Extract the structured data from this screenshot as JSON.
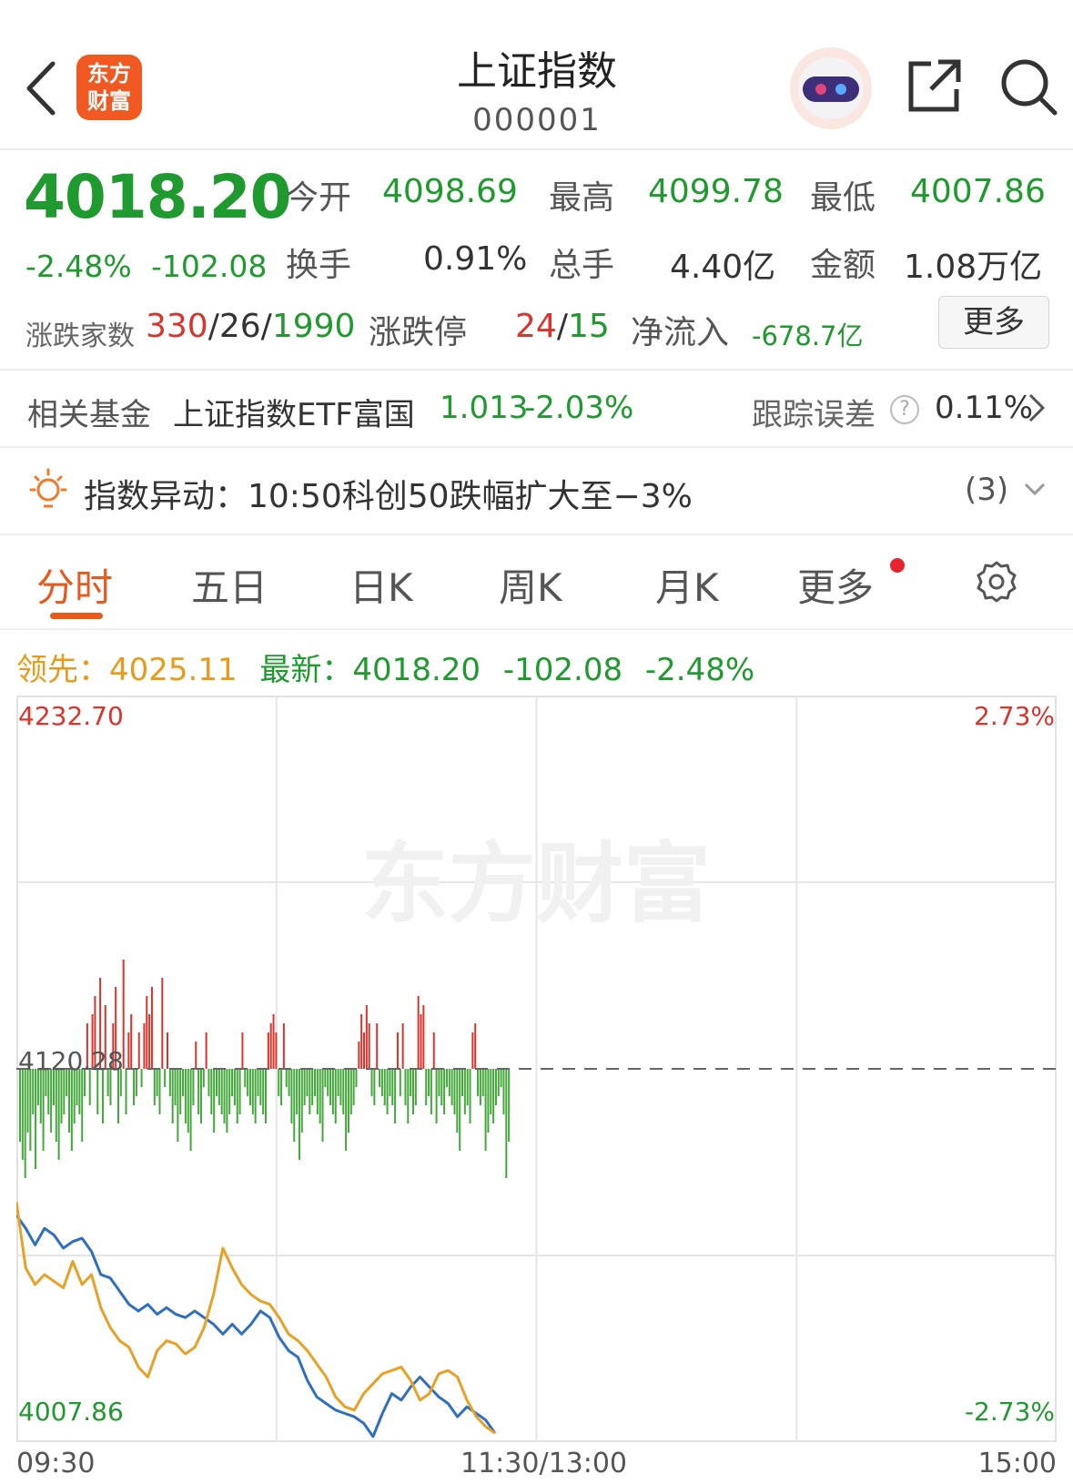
{
  "header": {
    "logo_line1": "东方",
    "logo_line2": "财富",
    "title": "上证指数",
    "code": "000001"
  },
  "quote": {
    "price": "4018.20",
    "change_pct": "-2.48%",
    "change": "-102.08",
    "open_label": "今开",
    "open": "4098.69",
    "high_label": "最高",
    "high": "4099.78",
    "low_label": "最低",
    "low": "4007.86",
    "turnover_label": "换手",
    "turnover": "0.91%",
    "volume_label": "总手",
    "volume": "4.40亿",
    "amount_label": "金额",
    "amount": "1.08万亿",
    "breadth_label": "涨跌家数",
    "breadth_up": "330",
    "breadth_flat": "26",
    "breadth_down": "1990",
    "limit_label": "涨跌停",
    "limit_up": "24",
    "limit_down": "15",
    "netflow_label": "净流入",
    "netflow": "-678.7亿",
    "more_button": "更多"
  },
  "fund": {
    "label": "相关基金",
    "name": "上证指数ETF富国",
    "price": "1.013",
    "pct": "-2.03%",
    "tracking_label": "跟踪误差",
    "tracking_value": "0.11%"
  },
  "alert": {
    "text": "指数异动：10:50科创50跌幅扩大至−3%",
    "count": "(3)"
  },
  "tabs": [
    "分时",
    "五日",
    "日K",
    "周K",
    "月K",
    "更多"
  ],
  "info_line": {
    "lead_label": "领先：",
    "lead_value": "4025.11",
    "latest_label": "最新：",
    "latest_value": "4018.20",
    "latest_change": "-102.08",
    "latest_pct": "-2.48%"
  },
  "chart_data": {
    "type": "line",
    "y_top_label": "4232.70",
    "y_mid_label": "4120.28",
    "y_bottom_label": "4007.86",
    "pct_top_label": "2.73%",
    "pct_bottom_label": "-2.73%",
    "x_labels": [
      "09:30",
      "11:30/13:00",
      "15:00"
    ],
    "ylim": [
      4007.86,
      4232.7
    ],
    "prev_close": 4120.28,
    "watermark": "东方财富",
    "series": [
      {
        "color": "#2f6fbf",
        "values": [
          4076,
          4072,
          4067,
          4072,
          4070,
          4066,
          4068,
          4069,
          4065,
          4058,
          4057,
          4053,
          4049,
          4047,
          4049,
          4046,
          4048,
          4046,
          4045,
          4047,
          4045,
          4043,
          4040,
          4043,
          4040,
          4043,
          4047,
          4045,
          4039,
          4035,
          4033,
          4026,
          4021,
          4019,
          4017,
          4016,
          4015,
          4013,
          4009,
          4016,
          4022,
          4020,
          4024,
          4027,
          4024,
          4021,
          4019,
          4015,
          4018,
          4016,
          4014,
          4010
        ]
      },
      {
        "color": "#e8a025",
        "values": [
          4080,
          4060,
          4055,
          4058,
          4056,
          4054,
          4062,
          4055,
          4058,
          4048,
          4042,
          4038,
          4036,
          4030,
          4027,
          4035,
          4038,
          4037,
          4034,
          4036,
          4042,
          4052,
          4066,
          4060,
          4055,
          4052,
          4050,
          4049,
          4045,
          4040,
          4038,
          4035,
          4031,
          4027,
          4021,
          4018,
          4017,
          4022,
          4025,
          4028,
          4029,
          4030,
          4026,
          4020,
          4022,
          4028,
          4029,
          4027,
          4020,
          4015,
          4012,
          4010
        ]
      }
    ],
    "volume_bars": [
      -8,
      -10,
      -12,
      -7,
      -9,
      -5,
      -11,
      -4,
      -6,
      -9,
      -3,
      -5,
      -7,
      -4,
      -8,
      -10,
      -6,
      -5,
      -3,
      -7,
      -9,
      -6,
      -4,
      -5,
      -8,
      -3,
      5,
      -4,
      6,
      8,
      -5,
      10,
      -6,
      7,
      -3,
      -4,
      5,
      9,
      -6,
      -3,
      12,
      -5,
      4,
      6,
      -4,
      -3,
      4,
      -2,
      5,
      8,
      6,
      9,
      -4,
      -3,
      -5,
      10,
      -2,
      4,
      -3,
      -6,
      -4,
      -8,
      -5,
      -3,
      -6,
      -7,
      -9,
      -4,
      3,
      -5,
      -6,
      -2,
      4,
      -3,
      -5,
      -7,
      -3,
      -4,
      -5,
      -6,
      -7,
      -5,
      -3,
      -4,
      -6,
      -5,
      4,
      -2,
      -3,
      -4,
      -5,
      -6,
      -3,
      -4,
      -5,
      -6,
      4,
      5,
      6,
      4,
      -3,
      -4,
      5,
      -2,
      -3,
      -6,
      -8,
      -5,
      -10,
      -7,
      -4,
      -3,
      -5,
      -4,
      -3,
      -5,
      -6,
      -8,
      -2,
      -3,
      -4,
      -5,
      -6,
      -3,
      -4,
      -5,
      -9,
      -7,
      -5,
      -4,
      -2,
      3,
      6,
      4,
      7,
      5,
      -3,
      -4,
      5,
      -2,
      -3,
      -4,
      -5,
      -3,
      -4,
      -6,
      4,
      -3,
      5,
      -4,
      -6,
      -3,
      -5,
      -4,
      8,
      6,
      7,
      -4,
      -3,
      -5,
      4,
      -6,
      -3,
      -4,
      -5,
      -2,
      -3,
      -4,
      -5,
      -7,
      -9,
      -3,
      -5,
      -4,
      -6,
      4,
      5,
      -3,
      -4,
      -3,
      -9,
      -7,
      -5,
      -6,
      -4,
      -3,
      -2,
      -5,
      -12,
      -8
    ]
  }
}
